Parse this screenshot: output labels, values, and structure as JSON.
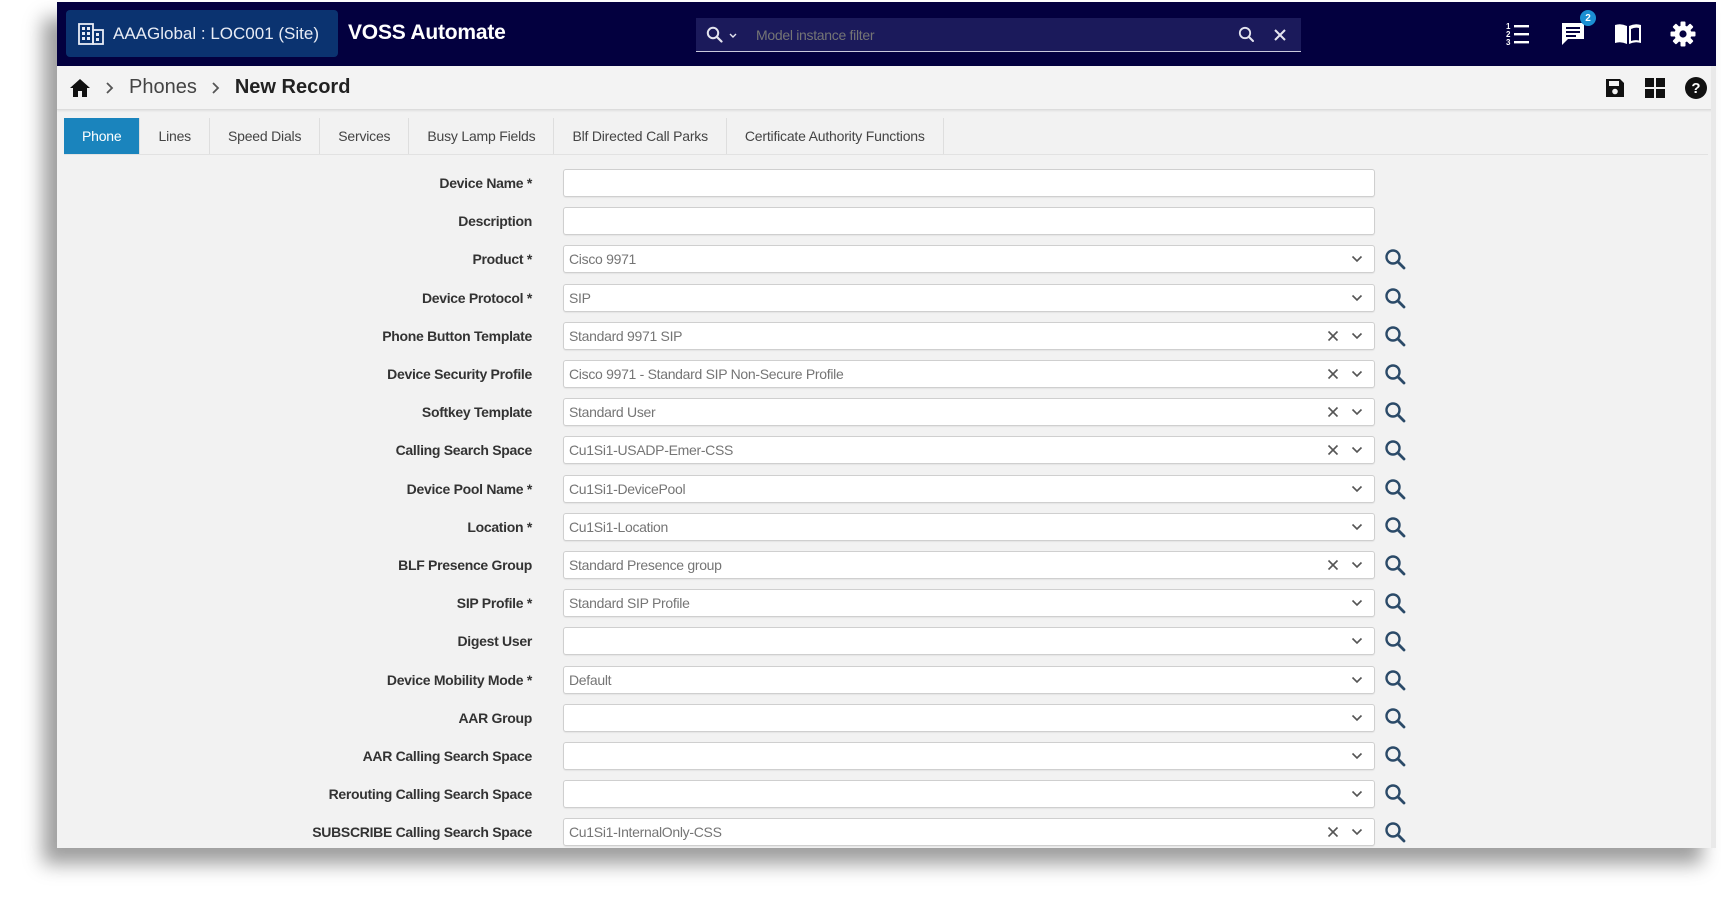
{
  "header": {
    "site_label": "AAAGlobal : LOC001 (Site)",
    "app_title": "VOSS Automate",
    "search": {
      "placeholder": "Model instance filter"
    },
    "notifications_count": "2",
    "icons": [
      "numbered-list-icon",
      "chat-icon",
      "book-icon",
      "gear-icon"
    ]
  },
  "breadcrumb": {
    "items": [
      "Phones"
    ],
    "current": "New Record"
  },
  "toolbar": {
    "icons": [
      "save-icon",
      "grid-icon",
      "help-icon"
    ]
  },
  "tabs": [
    {
      "label": "Phone",
      "active": true
    },
    {
      "label": "Lines",
      "active": false
    },
    {
      "label": "Speed Dials",
      "active": false
    },
    {
      "label": "Services",
      "active": false
    },
    {
      "label": "Busy Lamp Fields",
      "active": false
    },
    {
      "label": "Blf Directed Call Parks",
      "active": false
    },
    {
      "label": "Certificate Authority Functions",
      "active": false
    }
  ],
  "form": {
    "fields": [
      {
        "label": "Device Name *",
        "value": "",
        "type": "text",
        "clearable": false,
        "lookup": false
      },
      {
        "label": "Description",
        "value": "",
        "type": "text",
        "clearable": false,
        "lookup": false
      },
      {
        "label": "Product *",
        "value": "Cisco 9971",
        "type": "select",
        "clearable": false,
        "lookup": true
      },
      {
        "label": "Device Protocol *",
        "value": "SIP",
        "type": "select",
        "clearable": false,
        "lookup": true
      },
      {
        "label": "Phone Button Template",
        "value": "Standard 9971 SIP",
        "type": "select",
        "clearable": true,
        "lookup": true
      },
      {
        "label": "Device Security Profile",
        "value": "Cisco 9971 - Standard SIP Non-Secure Profile",
        "type": "select",
        "clearable": true,
        "lookup": true
      },
      {
        "label": "Softkey Template",
        "value": "Standard User",
        "type": "select",
        "clearable": true,
        "lookup": true
      },
      {
        "label": "Calling Search Space",
        "value": "Cu1Si1-USADP-Emer-CSS",
        "type": "select",
        "clearable": true,
        "lookup": true
      },
      {
        "label": "Device Pool Name *",
        "value": "Cu1Si1-DevicePool",
        "type": "select",
        "clearable": false,
        "lookup": true
      },
      {
        "label": "Location *",
        "value": "Cu1Si1-Location",
        "type": "select",
        "clearable": false,
        "lookup": true
      },
      {
        "label": "BLF Presence Group",
        "value": "Standard Presence group",
        "type": "select",
        "clearable": true,
        "lookup": true
      },
      {
        "label": "SIP Profile *",
        "value": "Standard SIP Profile",
        "type": "select",
        "clearable": false,
        "lookup": true
      },
      {
        "label": "Digest User",
        "value": "",
        "type": "select",
        "clearable": false,
        "lookup": true
      },
      {
        "label": "Device Mobility Mode *",
        "value": "Default",
        "type": "select",
        "clearable": false,
        "lookup": true
      },
      {
        "label": "AAR Group",
        "value": "",
        "type": "select",
        "clearable": false,
        "lookup": true
      },
      {
        "label": "AAR Calling Search Space",
        "value": "",
        "type": "select",
        "clearable": false,
        "lookup": true
      },
      {
        "label": "Rerouting Calling Search Space",
        "value": "",
        "type": "select",
        "clearable": false,
        "lookup": true
      },
      {
        "label": "SUBSCRIBE Calling Search Space",
        "value": "Cu1Si1-InternalOnly-CSS",
        "type": "select",
        "clearable": true,
        "lookup": true
      }
    ]
  },
  "colors": {
    "header_bg": "#03003f",
    "site_chip_bg": "#0b3370",
    "search_bg": "#1b1a5b",
    "active_tab": "#1a84bd",
    "badge": "#1b8fd2",
    "lookup_icon": "#2b4a68"
  }
}
